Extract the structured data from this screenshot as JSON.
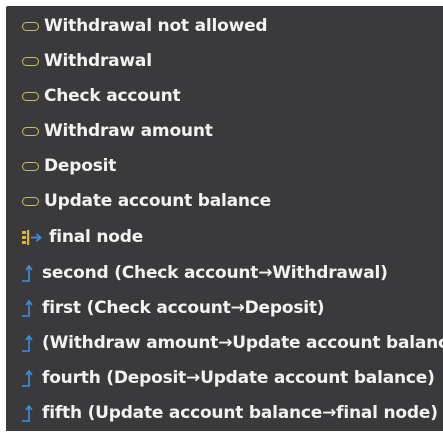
{
  "states": [
    {
      "label": "Withdrawal not allowed",
      "icon": "state-oval-icon"
    },
    {
      "label": "Withdrawal",
      "icon": "state-oval-icon"
    },
    {
      "label": "Check account",
      "icon": "state-oval-icon"
    },
    {
      "label": "Withdraw amount",
      "icon": "state-oval-icon"
    },
    {
      "label": "Deposit",
      "icon": "state-oval-icon"
    },
    {
      "label": "Update account balance",
      "icon": "state-oval-icon"
    }
  ],
  "final_node": {
    "label": "final node",
    "icon": "final-node-icon"
  },
  "transitions": [
    {
      "label": "second (Check account→Withdrawal)",
      "icon": "transition-arrow-icon"
    },
    {
      "label": "first (Check account→Deposit)",
      "icon": "transition-arrow-icon"
    },
    {
      "label": "(Withdraw amount→Update account balance)",
      "icon": "transition-arrow-icon"
    },
    {
      "label": "fourth (Deposit→Update account balance)",
      "icon": "transition-arrow-icon"
    },
    {
      "label": "fifth (Update account balance→final node)",
      "icon": "transition-arrow-icon"
    }
  ],
  "colors": {
    "background": "#3a3a3c",
    "text": "#f2f2f2",
    "state_icon": "#c8c060",
    "final_icon": "#d6b83a",
    "transition_icon": "#3c8ee0"
  }
}
